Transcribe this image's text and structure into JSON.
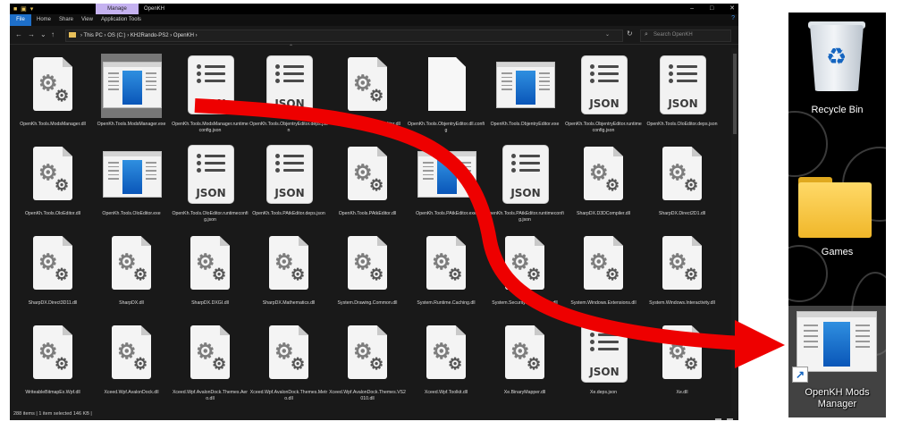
{
  "window": {
    "title": "OpenKH",
    "manage_tab": "Manage",
    "controls": [
      "–",
      "□",
      "✕"
    ]
  },
  "ribbon": {
    "tabs": [
      "File",
      "Home",
      "Share",
      "View",
      "Application Tools"
    ],
    "help": "?"
  },
  "address": {
    "path": "› This PC › OS (C:) › KH2Rando-PS2 › OpenKH ›",
    "search_placeholder": "Search OpenKH"
  },
  "files": [
    {
      "name": "OpenKh.Tools.ModsManager.dll",
      "type": "dll"
    },
    {
      "name": "OpenKh.Tools.ModsManager.exe",
      "type": "exe",
      "selected": true
    },
    {
      "name": "OpenKh.Tools.ModsManager.runtimeconfig.json",
      "type": "json"
    },
    {
      "name": "OpenKh.Tools.ObjentryEditor.deps.json",
      "type": "json"
    },
    {
      "name": "OpenKh.Tools.ObjentryEditor.dll",
      "type": "dll"
    },
    {
      "name": "OpenKh.Tools.ObjentryEditor.dll.config",
      "type": "blank"
    },
    {
      "name": "OpenKh.Tools.ObjentryEditor.exe",
      "type": "exe"
    },
    {
      "name": "OpenKh.Tools.ObjentryEditor.runtimeconfig.json",
      "type": "json"
    },
    {
      "name": "OpenKh.Tools.OloEditor.deps.json",
      "type": "json"
    },
    {
      "name": "OpenKh.Tools.OloEditor.dll",
      "type": "dll"
    },
    {
      "name": "OpenKh.Tools.OloEditor.exe",
      "type": "exe"
    },
    {
      "name": "OpenKh.Tools.OloEditor.runtimeconfig.json",
      "type": "json"
    },
    {
      "name": "OpenKh.Tools.PAtkEditor.deps.json",
      "type": "json"
    },
    {
      "name": "OpenKh.Tools.PAtkEditor.dll",
      "type": "dll"
    },
    {
      "name": "OpenKh.Tools.PAtkEditor.exe",
      "type": "exe"
    },
    {
      "name": "OpenKh.Tools.PAtkEditor.runtimeconfig.json",
      "type": "json"
    },
    {
      "name": "SharpDX.D3DCompiler.dll",
      "type": "dll"
    },
    {
      "name": "SharpDX.Direct2D1.dll",
      "type": "dll"
    },
    {
      "name": "SharpDX.Direct3D11.dll",
      "type": "dll"
    },
    {
      "name": "SharpDX.dll",
      "type": "dll"
    },
    {
      "name": "SharpDX.DXGI.dll",
      "type": "dll"
    },
    {
      "name": "SharpDX.Mathematics.dll",
      "type": "dll"
    },
    {
      "name": "System.Drawing.Common.dll",
      "type": "dll"
    },
    {
      "name": "System.Runtime.Caching.dll",
      "type": "dll"
    },
    {
      "name": "System.Security.Permissions.dll",
      "type": "dll"
    },
    {
      "name": "System.Windows.Extensions.dll",
      "type": "dll"
    },
    {
      "name": "System.Windows.Interactivity.dll",
      "type": "dll"
    },
    {
      "name": "WriteableBitmapEx.Wpf.dll",
      "type": "dll"
    },
    {
      "name": "Xceed.Wpf.AvalonDock.dll",
      "type": "dll"
    },
    {
      "name": "Xceed.Wpf.AvalonDock.Themes.Aero.dll",
      "type": "dll"
    },
    {
      "name": "Xceed.Wpf.AvalonDock.Themes.Metro.dll",
      "type": "dll"
    },
    {
      "name": "Xceed.Wpf.AvalonDock.Themes.VS2010.dll",
      "type": "dll"
    },
    {
      "name": "Xceed.Wpf.Toolkit.dll",
      "type": "dll"
    },
    {
      "name": "Xe.BinaryMapper.dll",
      "type": "dll"
    },
    {
      "name": "Xe.deps.json",
      "type": "json"
    },
    {
      "name": "Xe.dll",
      "type": "dll"
    }
  ],
  "json_label": "JSON",
  "status": {
    "text": "288 items  |  1 item selected  146 KB  |"
  },
  "desktop": {
    "items": [
      {
        "label": "Recycle Bin",
        "icon": "recycle-bin-icon"
      },
      {
        "label": "Games",
        "icon": "folder-icon"
      },
      {
        "label": "OpenKH Mods Manager",
        "icon": "shortcut-icon"
      }
    ]
  },
  "colors": {
    "arrow": "#ee0000",
    "explorer_bg": "#191919",
    "selection": "#777777",
    "accent_blue": "#1e6fc9"
  }
}
